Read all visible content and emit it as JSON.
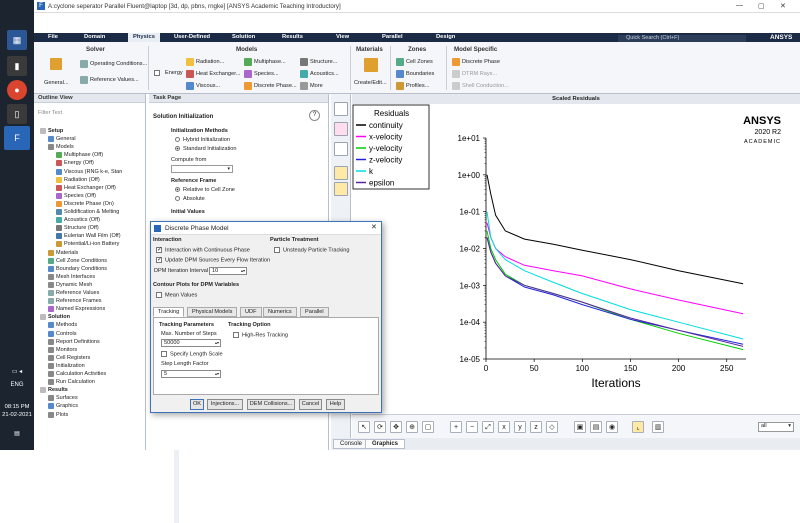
{
  "window": {
    "title": "A:cyclone seperator Parallel Fluent@laptop  [3d, dp, pbns, rngke] [ANSYS Academic Teaching Introductory]"
  },
  "menu": {
    "items": [
      "File",
      "Domain",
      "Physics",
      "User-Defined",
      "Solution",
      "Results",
      "View",
      "Parallel",
      "Design"
    ],
    "active": "Physics",
    "search_placeholder": "Quick Search (Ctrl+F)",
    "logo": "ANSYS"
  },
  "ribbon": {
    "solver": {
      "title": "Solver",
      "general": "General...",
      "operating": "Operating Conditions...",
      "reference": "Reference Values..."
    },
    "models": {
      "title": "Models",
      "energy": "Energy",
      "radiation": "Radiation...",
      "heat_exchanger": "Heat Exchanger...",
      "viscous": "Viscous...",
      "multiphase": "Multiphase...",
      "species": "Species...",
      "discrete_phase": "Discrete Phase...",
      "structure": "Structure...",
      "acoustics": "Acoustics...",
      "more": "More"
    },
    "materials": {
      "title": "Materials",
      "create": "Create/Edit..."
    },
    "zones": {
      "title": "Zones",
      "cell_zones": "Cell Zones",
      "boundaries": "Boundaries",
      "profiles": "Profiles..."
    },
    "model_specific": {
      "title": "Model Specific",
      "discrete_phase": "Discrete Phase",
      "dtrm": "DTRM Rays...",
      "shell": "Shell Conduction..."
    }
  },
  "outline": {
    "title": "Outline View",
    "filter": "Filter Text",
    "items": [
      "Setup",
      "General",
      "Models",
      "Multiphase (Off)",
      "Energy (Off)",
      "Viscous (RNG k-e, Stan",
      "Radiation (Off)",
      "Heat Exchanger (Off)",
      "Species (Off)",
      "Discrete Phase (On)",
      "Solidification & Melting",
      "Acoustics (Off)",
      "Structure (Off)",
      "Eulerian Wall Film (Off)",
      "Potential/Li-ion Battery",
      "Materials",
      "Cell Zone Conditions",
      "Boundary Conditions",
      "Mesh Interfaces",
      "Dynamic Mesh",
      "Reference Values",
      "Reference Frames",
      "Named Expressions",
      "Solution",
      "Methods",
      "Controls",
      "Report Definitions",
      "Monitors",
      "Cell Registers",
      "Initialization",
      "Calculation Activities",
      "Run Calculation",
      "Results",
      "Surfaces",
      "Graphics",
      "Plots"
    ]
  },
  "taskpage": {
    "title": "Task Page",
    "heading": "Solution Initialization",
    "methods_label": "Initialization Methods",
    "hybrid": "Hybrid  Initialization",
    "standard": "Standard Initialization",
    "compute_from": "Compute from",
    "reference_frame": "Reference Frame",
    "relative": "Relative to Cell Zone",
    "absolute": "Absolute",
    "initial_values": "Initial Values",
    "help_icon": "?"
  },
  "taskbar": {
    "lang": "ENG",
    "time": "08:15 PM",
    "date": "21-02-2021"
  },
  "graphics": {
    "title": "Scaled Residuals",
    "brand": "ANSYS",
    "version": "2020 R2",
    "edition": "ACADEMIC"
  },
  "chart_data": {
    "type": "line",
    "title": "",
    "xlabel": "Iterations",
    "ylabel": "",
    "y_scale": "log",
    "xlim": [
      0,
      270
    ],
    "ylim": [
      1e-05,
      10
    ],
    "x_ticks": [
      "0",
      "50",
      "100",
      "150",
      "200",
      "250"
    ],
    "y_ticks": [
      "1e+01",
      "1e+00",
      "1e-01",
      "1e-02",
      "1e-03",
      "1e-04",
      "1e-05"
    ],
    "legend_title": "Residuals",
    "legend_position": "top-left",
    "series": [
      {
        "name": "continuity",
        "color": "#000000",
        "x": [
          1,
          5,
          10,
          20,
          40,
          70,
          100,
          150,
          200,
          267
        ],
        "values": [
          1,
          0.3,
          0.08,
          0.03,
          0.018,
          0.013,
          0.009,
          0.005,
          0.0025,
          0.0011
        ]
      },
      {
        "name": "x-velocity",
        "color": "#ff00ff",
        "x": [
          1,
          5,
          10,
          20,
          40,
          70,
          100,
          150,
          200,
          267
        ],
        "values": [
          0.05,
          0.02,
          0.01,
          0.006,
          0.0035,
          0.0025,
          0.0018,
          0.0008,
          0.0004,
          0.00017
        ]
      },
      {
        "name": "y-velocity",
        "color": "#00cc00",
        "x": [
          1,
          5,
          10,
          20,
          40,
          70,
          100,
          150,
          200,
          267
        ],
        "values": [
          0.03,
          0.01,
          0.005,
          0.002,
          0.001,
          0.0006,
          0.00035,
          0.00012,
          5e-05,
          1.8e-05
        ]
      },
      {
        "name": "z-velocity",
        "color": "#2020dd",
        "x": [
          1,
          5,
          10,
          20,
          40,
          70,
          100,
          150,
          200,
          267
        ],
        "values": [
          0.02,
          0.008,
          0.004,
          0.0018,
          0.0009,
          0.00055,
          0.0003,
          0.00012,
          6e-05,
          2.5e-05
        ]
      },
      {
        "name": "k",
        "color": "#00dddd",
        "x": [
          1,
          5,
          10,
          20,
          40,
          70,
          100,
          150,
          200,
          267
        ],
        "values": [
          0.1,
          0.02,
          0.01,
          0.005,
          0.0025,
          0.0012,
          0.0006,
          0.00022,
          0.0001,
          3.5e-05
        ]
      },
      {
        "name": "epsilon",
        "color": "#5a2a9a",
        "x": [
          1,
          5,
          10,
          20,
          40,
          70,
          100,
          150,
          200,
          267
        ],
        "values": [
          0.02,
          0.008,
          0.004,
          0.0018,
          0.001,
          0.0006,
          0.00035,
          0.00013,
          6e-05,
          2.2e-05
        ]
      }
    ]
  },
  "dialog": {
    "title": "Discrete Phase Model",
    "interaction": "Interaction",
    "interaction_continuous": "Interaction with Continuous Phase",
    "update_dpm": "Update DPM Sources Every Flow Iteration",
    "dpm_interval_label": "DPM Iteration Interval",
    "dpm_interval": "10",
    "particle_treatment": "Particle Treatment",
    "unsteady": "Unsteady Particle Tracking",
    "contour_plots": "Contour Plots for DPM Variables",
    "mean_values": "Mean Values",
    "tabs": [
      "Tracking",
      "Physical Models",
      "UDF",
      "Numerics",
      "Parallel"
    ],
    "tracking_params": "Tracking Parameters",
    "max_steps_label": "Max. Number of Steps",
    "max_steps": "50000",
    "specify_length": "Specify Length Scale",
    "step_length_label": "Step Length Factor",
    "step_length": "5",
    "tracking_option": "Tracking Option",
    "high_res": "High-Res Tracking",
    "buttons": {
      "ok": "OK",
      "injections": "Injections...",
      "dem": "DEM Collisions...",
      "cancel": "Cancel",
      "help": "Help"
    }
  },
  "gtoolbar": {
    "view_select": "all"
  },
  "bottom_tabs": [
    "Console",
    "Graphics"
  ],
  "colors": {
    "accent": "#1b2b45",
    "selection": "#3c73b8"
  }
}
